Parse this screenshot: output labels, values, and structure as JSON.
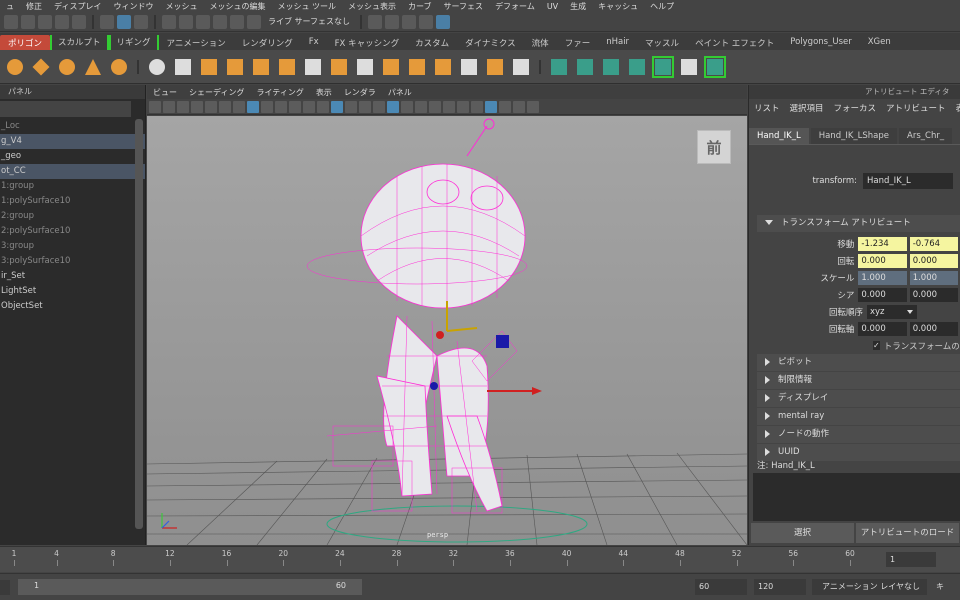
{
  "menubar": [
    "ュ",
    "修正",
    "ディスプレイ",
    "ウィンドウ",
    "メッシュ",
    "メッシュの編集",
    "メッシュ ツール",
    "メッシュ表示",
    "カーブ",
    "サーフェス",
    "デフォーム",
    "UV",
    "生成",
    "キャッシュ",
    "ヘルプ"
  ],
  "statusline": {
    "live_surface": "ライブ サーフェスなし"
  },
  "shelf_tabs": [
    "ポリゴン",
    "スカルプト",
    "リギング",
    "アニメーション",
    "レンダリング",
    "Fx",
    "FX キャッシング",
    "カスタム",
    "ダイナミクス",
    "流体",
    "ファー",
    "nHair",
    "マッスル",
    "ペイント エフェクト",
    "Polygons_User",
    "XGen"
  ],
  "outliner": {
    "header": "パネル",
    "items": [
      {
        "label": "_Loc",
        "style": "grey"
      },
      {
        "label": "g_V4",
        "style": "sel"
      },
      {
        "label": "_geo",
        "style": "normal"
      },
      {
        "label": "ot_CC",
        "style": "sel"
      },
      {
        "label": "1:group",
        "style": "grey"
      },
      {
        "label": "1:polySurface10",
        "style": "grey"
      },
      {
        "label": "2:group",
        "style": "grey"
      },
      {
        "label": "2:polySurface10",
        "style": "grey"
      },
      {
        "label": "3:group",
        "style": "grey"
      },
      {
        "label": "3:polySurface10",
        "style": "grey"
      },
      {
        "label": "ir_Set",
        "style": "normal"
      },
      {
        "label": "LightSet",
        "style": "normal"
      },
      {
        "label": "ObjectSet",
        "style": "normal"
      }
    ]
  },
  "viewport": {
    "menu": [
      "ビュー",
      "シェーディング",
      "ライティング",
      "表示",
      "レンダラ",
      "パネル"
    ],
    "viewcube_label": "前",
    "camera": "persp"
  },
  "attribute_editor": {
    "title": "アトリビュート エディタ",
    "menu": [
      "リスト",
      "選択項目",
      "フォーカス",
      "アトリビュート",
      "表示"
    ],
    "tabs": [
      "Hand_IK_L",
      "Hand_IK_LShape",
      "Ars_Chr_"
    ],
    "transform_label": "transform:",
    "transform_value": "Hand_IK_L",
    "section_transform": "トランスフォーム アトリビュート",
    "rows": {
      "translate": {
        "label": "移動",
        "x": "-1.234",
        "y": "-0.764"
      },
      "rotate": {
        "label": "回転",
        "x": "0.000",
        "y": "0.000"
      },
      "scale": {
        "label": "スケール",
        "x": "1.000",
        "y": "1.000"
      },
      "shear": {
        "label": "シア",
        "x": "0.000",
        "y": "0.000"
      },
      "rotate_order": {
        "label": "回転順序",
        "value": "xyz"
      },
      "rotate_axis": {
        "label": "回転軸",
        "x": "0.000",
        "y": "0.000"
      },
      "inherit": "トランスフォームの継承"
    },
    "sections": [
      "ピボット",
      "制限情報",
      "ディスプレイ",
      "mental ray",
      "ノードの動作",
      "UUID"
    ],
    "notes": "注: Hand_IK_L",
    "buttons": [
      "選択",
      "アトリビュートのロード"
    ]
  },
  "timeline": {
    "ticks": [
      "1",
      "4",
      "8",
      "12",
      "16",
      "20",
      "24",
      "28",
      "32",
      "36",
      "40",
      "44",
      "48",
      "52",
      "56",
      "60"
    ],
    "current_frame": "1"
  },
  "range": {
    "start": "1",
    "range_end": "60",
    "end": "60",
    "anim_end": "120",
    "anim_layer": "アニメーション レイヤなし",
    "key": "キ"
  },
  "colors": {
    "accent_tab": "#c44a3a",
    "selection_wire": "#ff00ff",
    "shelf_orange": "#e59a3a"
  }
}
